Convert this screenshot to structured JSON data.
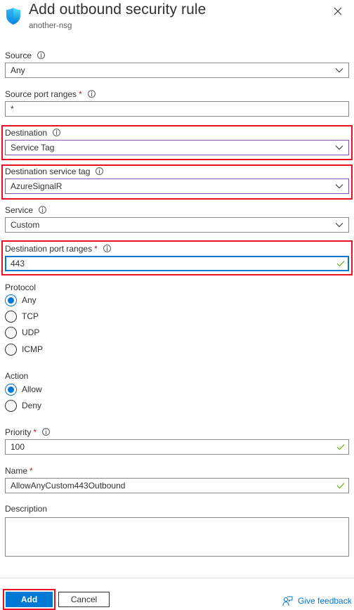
{
  "header": {
    "title": "Add outbound security rule",
    "subtitle": "another-nsg",
    "icon": "shield-icon",
    "close_icon": "close-icon"
  },
  "fields": {
    "source": {
      "label": "Source",
      "value": "Any",
      "required": false,
      "info": true
    },
    "source_port_ranges": {
      "label": "Source port ranges",
      "value": "*",
      "required": true,
      "info": true
    },
    "destination": {
      "label": "Destination",
      "value": "Service Tag",
      "required": false,
      "info": true
    },
    "destination_service_tag": {
      "label": "Destination service tag",
      "value": "AzureSignalR",
      "required": false,
      "info": true
    },
    "service": {
      "label": "Service",
      "value": "Custom",
      "required": false,
      "info": true
    },
    "destination_port_ranges": {
      "label": "Destination port ranges",
      "value": "443",
      "required": true,
      "info": true,
      "valid": true
    },
    "priority": {
      "label": "Priority",
      "value": "100",
      "required": true,
      "info": true,
      "valid": true
    },
    "name": {
      "label": "Name",
      "value": "AllowAnyCustom443Outbound",
      "required": true,
      "valid": true
    },
    "description": {
      "label": "Description",
      "value": ""
    }
  },
  "protocol": {
    "label": "Protocol",
    "options": [
      "Any",
      "TCP",
      "UDP",
      "ICMP"
    ],
    "selected": "Any"
  },
  "action": {
    "label": "Action",
    "options": [
      "Allow",
      "Deny"
    ],
    "selected": "Allow"
  },
  "footer": {
    "add_label": "Add",
    "cancel_label": "Cancel",
    "feedback_label": "Give feedback",
    "feedback_icon": "feedback-icon"
  },
  "colors": {
    "accent": "#0078d4",
    "highlight": "#e81123",
    "required": "#a4262c",
    "valid_check": "#57a300",
    "dropdown_focus": "#8c4fab"
  },
  "required_marker": "*"
}
